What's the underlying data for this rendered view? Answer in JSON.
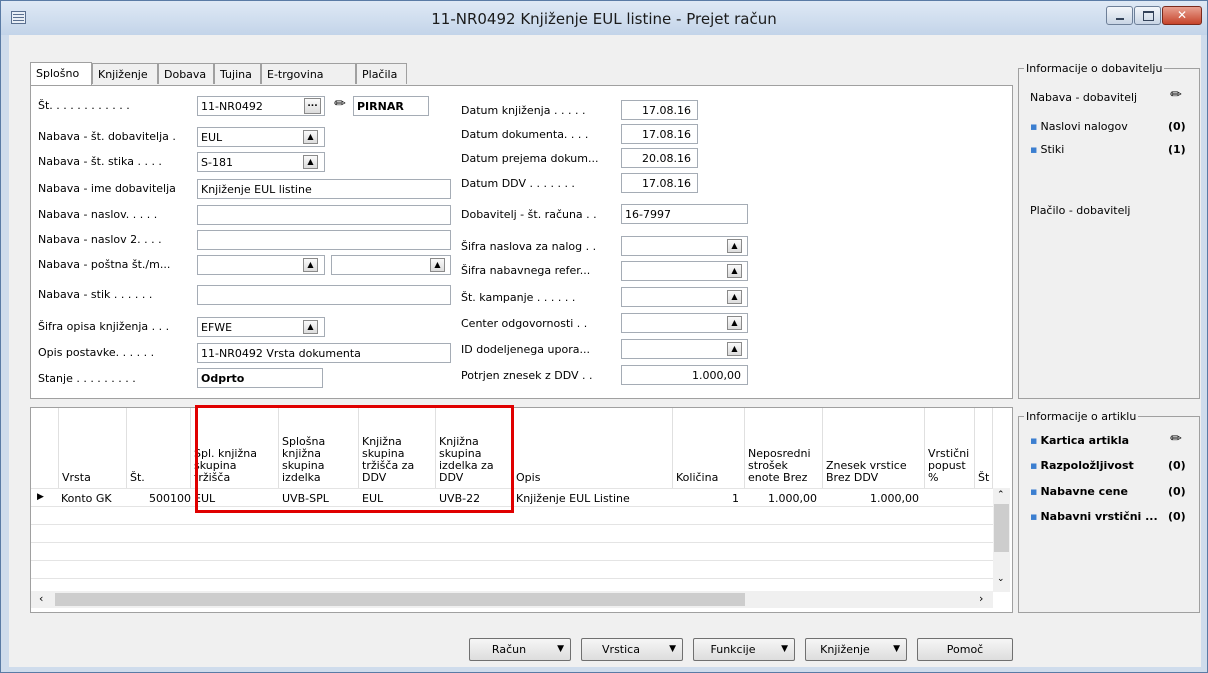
{
  "window": {
    "title": "11-NR0492 Knjiženje EUL listine - Prejet račun"
  },
  "tabs": [
    "Splošno",
    "Knjiženje",
    "Dobava",
    "Tujina",
    "E-trgovina",
    "Plačila"
  ],
  "general_left": [
    {
      "label": "Št. . . . . . . . . . . .",
      "value": "11-NR0492"
    },
    {
      "label": "Nabava - št. dobavitelja .",
      "value": "EUL"
    },
    {
      "label": "Nabava - št. stika . . . .",
      "value": "S-181"
    },
    {
      "label": "Nabava - ime dobavitelja",
      "value": "Knjiženje EUL listine"
    },
    {
      "label": "Nabava - naslov. . . . .",
      "value": ""
    },
    {
      "label": "Nabava - naslov 2. . . .",
      "value": ""
    },
    {
      "label": "Nabava - poštna št./m...",
      "value": ""
    },
    {
      "label": "Nabava - stik . . . . . .",
      "value": ""
    },
    {
      "label": "Šifra opisa knjiženja . . .",
      "value": "EFWE"
    },
    {
      "label": "Opis postavke. . . . . .",
      "value": "11-NR0492 Vrsta dokumenta"
    },
    {
      "label": "Stanje . . . . . . . . .",
      "value": "Odprto"
    }
  ],
  "assigned_user": "PIRNAR",
  "general_right": [
    {
      "label": "Datum knjiženja . . . . .",
      "value": "17.08.16"
    },
    {
      "label": "Datum dokumenta. . . .",
      "value": "17.08.16"
    },
    {
      "label": "Datum prejema dokum...",
      "value": "20.08.16"
    },
    {
      "label": "Datum DDV . . . . . . .",
      "value": "17.08.16"
    },
    {
      "label": "Dobavitelj - št. računa . .",
      "value": "16-7997"
    },
    {
      "label": "Šifra naslova za nalog . .",
      "value": ""
    },
    {
      "label": "Šifra nabavnega refer...",
      "value": ""
    },
    {
      "label": "Št. kampanje . . . . . .",
      "value": ""
    },
    {
      "label": "Center odgovornosti . .",
      "value": ""
    },
    {
      "label": "ID dodeljenega upora...",
      "value": ""
    },
    {
      "label": "Potrjen znesek z DDV . .",
      "value": "1.000,00"
    }
  ],
  "vendor_info": {
    "title": "Informacije o dobavitelju",
    "header": "Nabava - dobavitelj",
    "items": [
      {
        "label": "Naslovi nalogov",
        "count": "(0)"
      },
      {
        "label": "Stiki",
        "count": "(1)"
      }
    ],
    "payment_label": "Plačilo - dobavitelj"
  },
  "item_info": {
    "title": "Informacije o artiklu",
    "items": [
      {
        "label": "Kartica artikla",
        "count": ""
      },
      {
        "label": "Razpoložljivost",
        "count": "(0)"
      },
      {
        "label": "Nabavne cene",
        "count": "(0)"
      },
      {
        "label": "Nabavni vrstični ...",
        "count": "(0)"
      }
    ]
  },
  "lines": {
    "headers": [
      "Vrsta",
      "Št.",
      "Spl. knjižna skupina tržišča",
      "Splošna knjižna skupina izdelka",
      "Knjižna skupina tržišča za DDV",
      "Knjižna skupina izdelka za DDV",
      "Opis",
      "Količina",
      "Neposredni strošek enote Brez",
      "Znesek vrstice Brez DDV",
      "Vrstični popust %",
      "Št"
    ],
    "rows": [
      [
        "Konto GK",
        "500100",
        "EUL",
        "UVB-SPL",
        "EUL",
        "UVB-22",
        "Knjiženje EUL Listine",
        "1",
        "1.000,00",
        "1.000,00",
        "",
        ""
      ]
    ]
  },
  "buttons": [
    {
      "label": "Račun",
      "dropdown": true
    },
    {
      "label": "Vrstica",
      "dropdown": true
    },
    {
      "label": "Funkcije",
      "dropdown": true
    },
    {
      "label": "Knjiženje",
      "dropdown": true
    },
    {
      "label": "Pomoč",
      "dropdown": false
    }
  ]
}
